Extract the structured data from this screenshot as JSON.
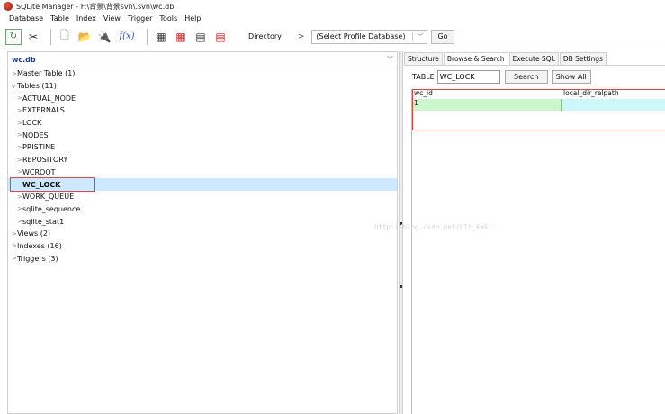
{
  "window": {
    "title": "SQLite Manager - F:\\背景\\背景svn\\.svn\\wc.db"
  },
  "menu": [
    "Database",
    "Table",
    "Index",
    "View",
    "Trigger",
    "Tools",
    "Help"
  ],
  "toolbar": {
    "icons": [
      "refresh-icon",
      "scissors-icon",
      "new-db-icon",
      "open-db-icon",
      "connect-icon",
      "function-icon",
      "create-table-icon",
      "drop-table-icon",
      "create-index-icon",
      "drop-index-icon"
    ],
    "fx_label": "f(x)",
    "directory_label": "Directory",
    "directory_arrow": ">",
    "profile_select": "(Select Profile Database)",
    "go_label": "Go"
  },
  "left": {
    "db_name": "wc.db",
    "tree": [
      {
        "label": "Master Table (1)",
        "caret": ">",
        "level": 1
      },
      {
        "label": "Tables (11)",
        "caret": "v",
        "level": 1
      },
      {
        "label": "ACTUAL_NODE",
        "caret": ">",
        "level": 2
      },
      {
        "label": "EXTERNALS",
        "caret": ">",
        "level": 2
      },
      {
        "label": "LOCK",
        "caret": ">",
        "level": 2
      },
      {
        "label": "NODES",
        "caret": ">",
        "level": 2
      },
      {
        "label": "PRISTINE",
        "caret": ">",
        "level": 2
      },
      {
        "label": "REPOSITORY",
        "caret": ">",
        "level": 2
      },
      {
        "label": "WCROOT",
        "caret": ">",
        "level": 2
      },
      {
        "label": "WC_LOCK",
        "caret": "",
        "level": 2,
        "selected": true
      },
      {
        "label": "WORK_QUEUE",
        "caret": ">",
        "level": 2
      },
      {
        "label": "sqlite_sequence",
        "caret": ">",
        "level": 2
      },
      {
        "label": "sqlite_stat1",
        "caret": ">",
        "level": 2
      },
      {
        "label": "Views (2)",
        "caret": ">",
        "level": 1
      },
      {
        "label": "Indexes (16)",
        "caret": ">",
        "level": 1
      },
      {
        "label": "Triggers (3)",
        "caret": ">",
        "level": 1
      }
    ]
  },
  "right": {
    "tabs": [
      "Structure",
      "Browse & Search",
      "Execute SQL",
      "DB Settings"
    ],
    "active_tab": 1,
    "table_label": "TABLE",
    "table_value": "WC_LOCK",
    "search_label": "Search",
    "show_all_label": "Show All",
    "grid": {
      "columns": [
        "wc_id",
        "local_dir_relpath"
      ],
      "rows": [
        [
          "1",
          ""
        ]
      ]
    }
  },
  "watermark": "http://blog.csdn.net/blt_kaki"
}
